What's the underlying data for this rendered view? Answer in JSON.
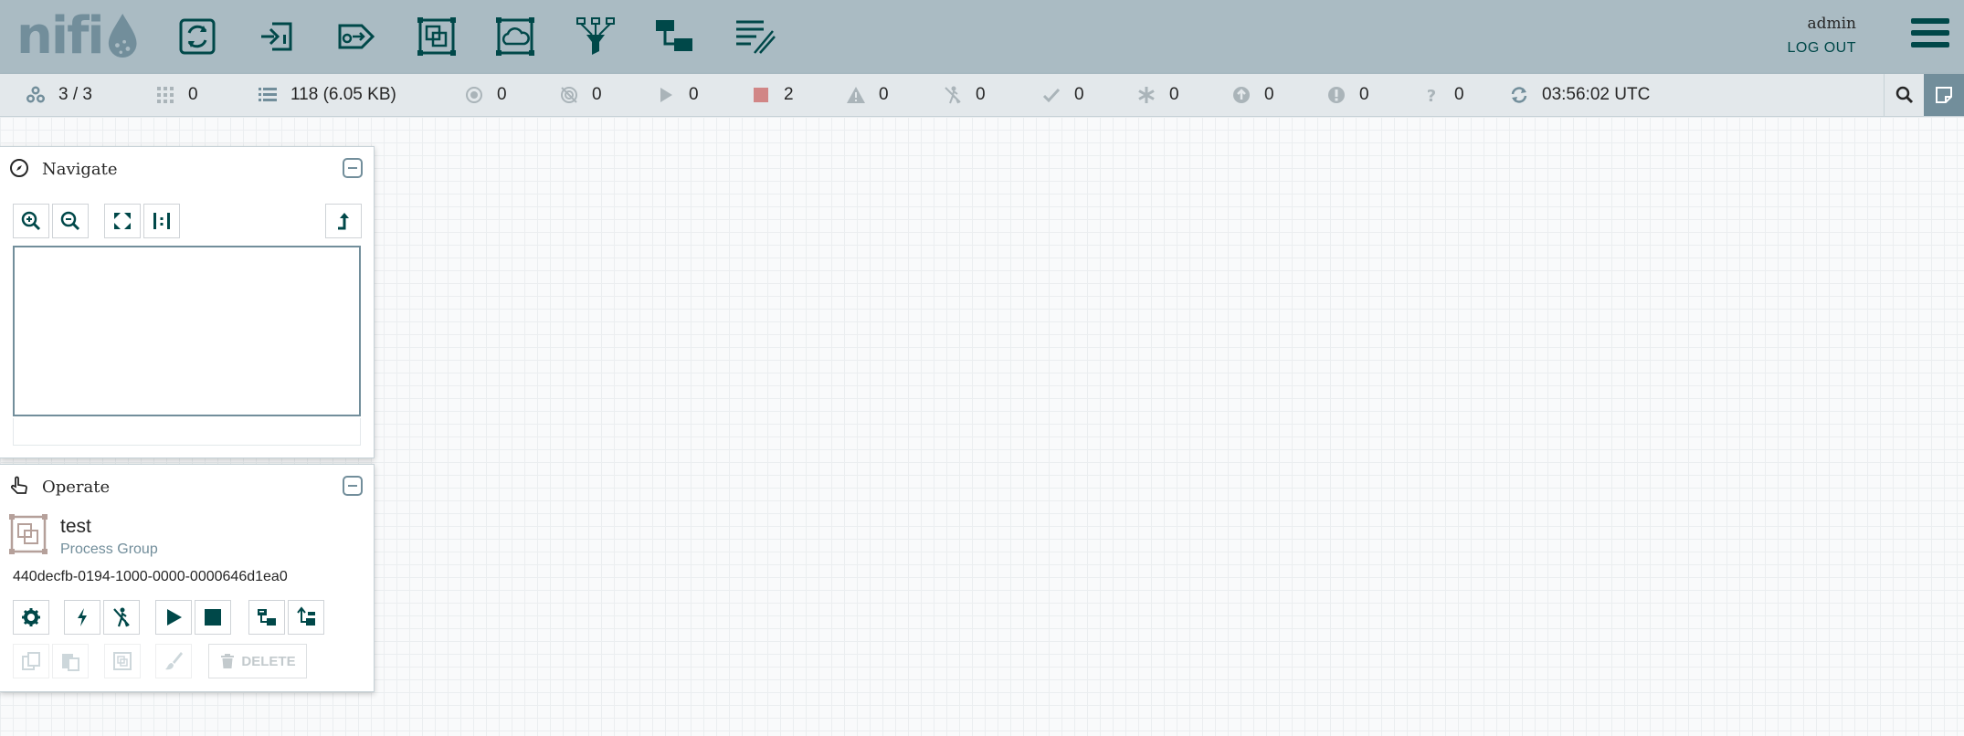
{
  "header": {
    "logo_text": "nifi",
    "user_name": "admin",
    "logout_label": "LOG OUT",
    "components": [
      {
        "name": "processor"
      },
      {
        "name": "input-port"
      },
      {
        "name": "output-port"
      },
      {
        "name": "process-group"
      },
      {
        "name": "remote-process-group"
      },
      {
        "name": "funnel"
      },
      {
        "name": "template"
      },
      {
        "name": "label"
      }
    ]
  },
  "status": {
    "cluster_nodes": "3 / 3",
    "active_threads": "0",
    "queued": "118 (6.05 KB)",
    "transmitting": "0",
    "not_transmitting": "0",
    "running": "0",
    "stopped": "2",
    "invalid": "0",
    "disabled": "0",
    "up_to_date": "0",
    "locally_modified": "0",
    "stale": "0",
    "locally_modified_stale": "0",
    "sync_failure": "0",
    "last_refreshed": "03:56:02 UTC"
  },
  "navigate": {
    "title": "Navigate"
  },
  "operate": {
    "title": "Operate",
    "selection_name": "test",
    "selection_type": "Process Group",
    "selection_id": "440decfb-0194-1000-0000-0000646d1ea0",
    "delete_label": "DELETE"
  },
  "colors": {
    "header_bg": "#aabbc3",
    "brand_dark": "#004849",
    "brand_muted": "#728e9b",
    "stopped_red": "#d18686"
  }
}
